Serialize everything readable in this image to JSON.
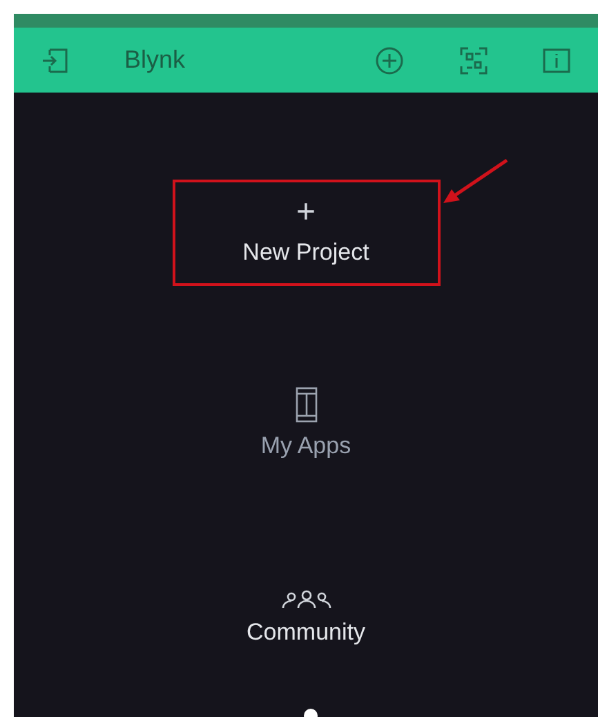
{
  "header": {
    "title": "Blynk"
  },
  "menu": [
    {
      "kind": "new",
      "symbol": "+",
      "label": "New Project",
      "highlighted": true,
      "dimmed": false
    },
    {
      "kind": "apps",
      "label": "My Apps",
      "highlighted": false,
      "dimmed": true
    },
    {
      "kind": "community",
      "label": "Community",
      "highlighted": false,
      "dimmed": false
    }
  ]
}
